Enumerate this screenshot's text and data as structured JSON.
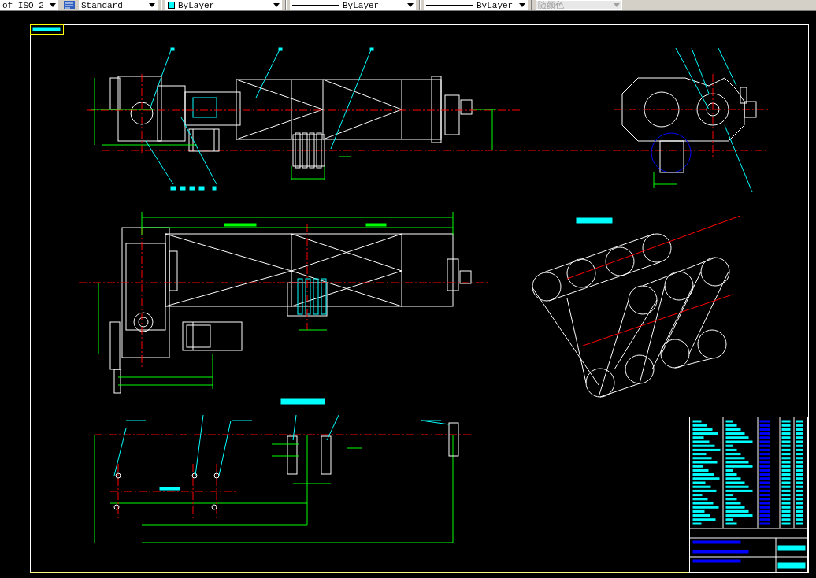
{
  "toolbar": {
    "combos": [
      {
        "kind": "text",
        "value": "of ISO-2",
        "disabled": false
      },
      {
        "kind": "text",
        "value": "Standard",
        "disabled": false
      },
      {
        "kind": "color",
        "value": "ByLayer",
        "color": "#00ffff",
        "disabled": false
      },
      {
        "kind": "linetype",
        "value": "ByLayer",
        "disabled": false
      },
      {
        "kind": "linetype",
        "value": "ByLayer",
        "disabled": false
      },
      {
        "kind": "text",
        "value": "随颜色",
        "disabled": true
      }
    ]
  }
}
